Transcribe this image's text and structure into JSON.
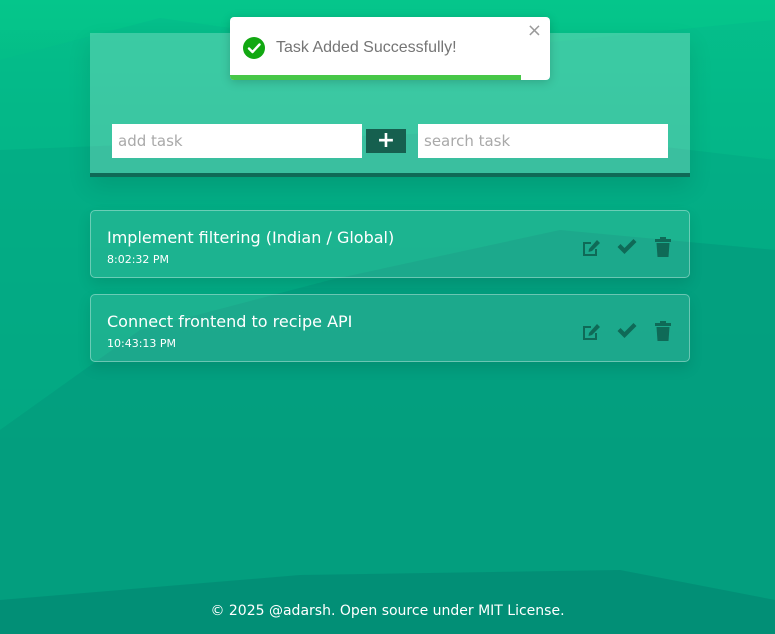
{
  "toast": {
    "icon": "check-circle-icon",
    "message": "Task Added Successfully!",
    "close_icon": "close-icon",
    "close_glyph": "×",
    "progress": 0.91,
    "colors": {
      "success": "#12a812",
      "progress": "#47c748"
    }
  },
  "input_panel": {
    "add_placeholder": "add task",
    "add_button_glyph": "+",
    "add_button_icon": "plus-icon",
    "search_placeholder": "search task"
  },
  "tasks": [
    {
      "title": "Implement filtering (Indian / Global)",
      "time": "8:02:32 PM"
    },
    {
      "title": "Connect frontend to recipe API",
      "time": "10:43:13 PM"
    }
  ],
  "task_actions": {
    "icons": [
      "edit-icon",
      "check-icon",
      "trash-icon"
    ],
    "icon_color": "#0f6a57"
  },
  "footer": {
    "text": "© 2025 @adarsh. Open source under MIT License."
  },
  "theme": {
    "accent": "#04c48c",
    "dark_accent": "#16604f"
  }
}
